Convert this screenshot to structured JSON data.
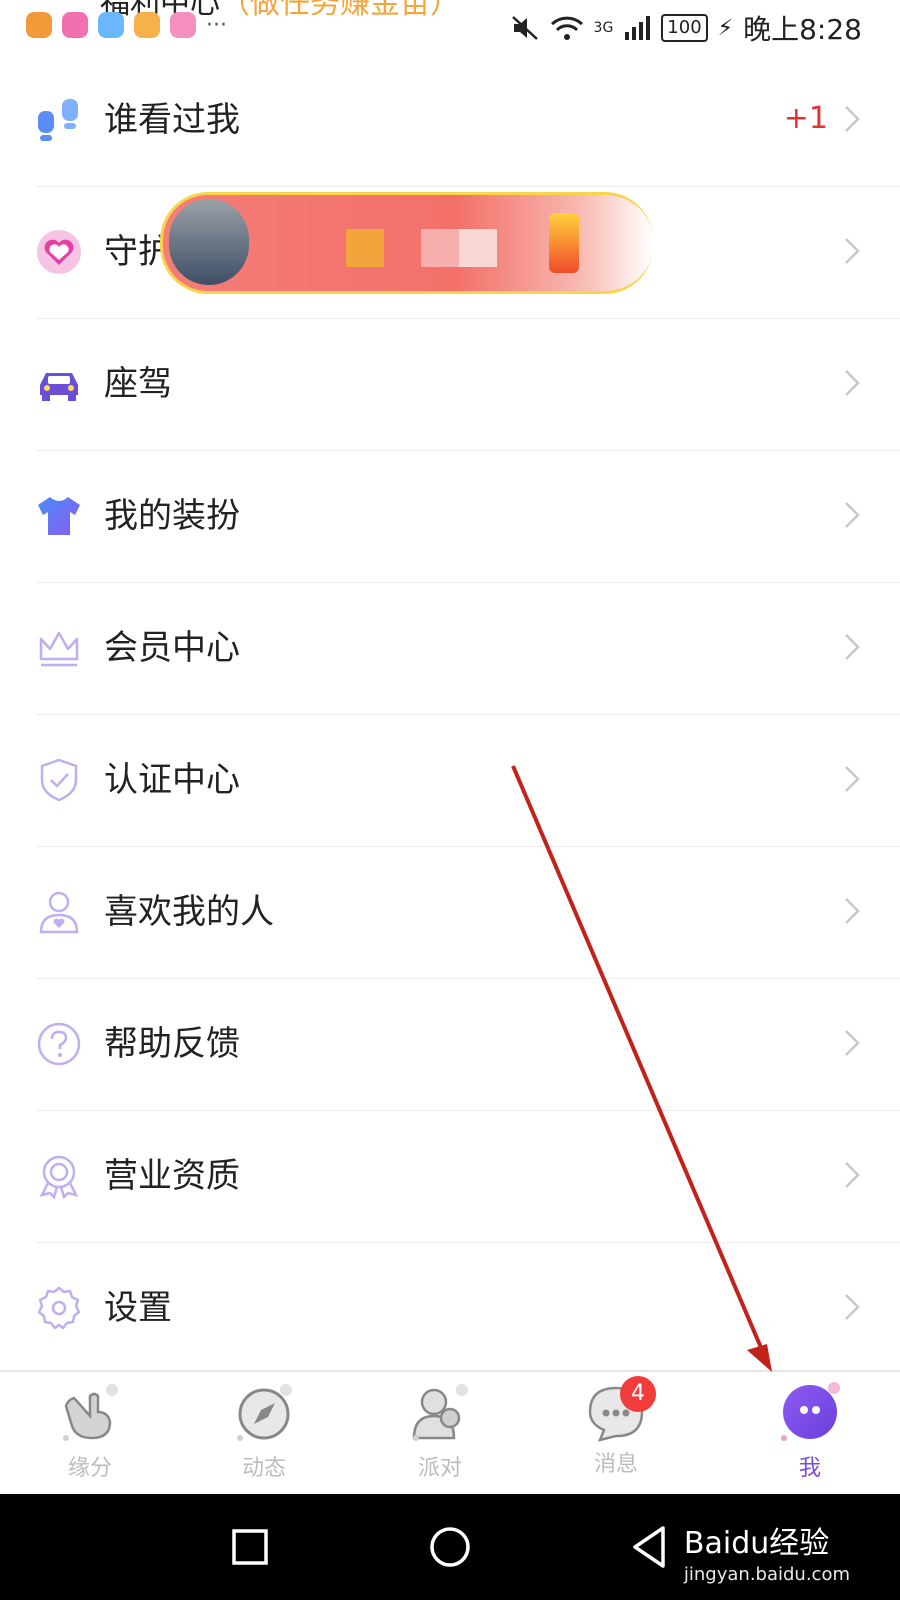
{
  "statusbar": {
    "top_partial_text": "福利中心",
    "top_partial_hint": "（做任务赚金苗）",
    "time": "晚上8:28",
    "battery": "100",
    "network": "3G",
    "more": "···"
  },
  "menu": [
    {
      "label": "谁看过我",
      "icon": "footprints-icon",
      "extra": "+1"
    },
    {
      "label": "守护",
      "icon": "heart-icon",
      "extra": ""
    },
    {
      "label": "座驾",
      "icon": "car-icon",
      "extra": ""
    },
    {
      "label": "我的装扮",
      "icon": "tshirt-icon",
      "extra": ""
    },
    {
      "label": "会员中心",
      "icon": "crown-icon",
      "extra": ""
    },
    {
      "label": "认证中心",
      "icon": "shield-check-icon",
      "extra": ""
    },
    {
      "label": "喜欢我的人",
      "icon": "user-heart-icon",
      "extra": ""
    },
    {
      "label": "帮助反馈",
      "icon": "question-icon",
      "extra": ""
    },
    {
      "label": "营业资质",
      "icon": "badge-ribbon-icon",
      "extra": ""
    },
    {
      "label": "设置",
      "icon": "gear-icon",
      "extra": ""
    }
  ],
  "tabs": [
    {
      "label": "缘分",
      "icon": "hand-icon",
      "active": false
    },
    {
      "label": "动态",
      "icon": "compass-icon",
      "active": false
    },
    {
      "label": "派对",
      "icon": "group-icon",
      "active": false
    },
    {
      "label": "消息",
      "icon": "chat-icon",
      "active": false,
      "badge": "4"
    },
    {
      "label": "我",
      "icon": "profile-icon",
      "active": true
    }
  ],
  "watermark": {
    "brand": "Baidu经验",
    "url": "jingyan.baidu.com"
  },
  "colors": {
    "accent": "#7b4ce0",
    "icon_purple": "#b9a4ee",
    "badge_red": "#f23b3b",
    "plus_red": "#e3322f",
    "arrow_red": "#c1221a"
  }
}
